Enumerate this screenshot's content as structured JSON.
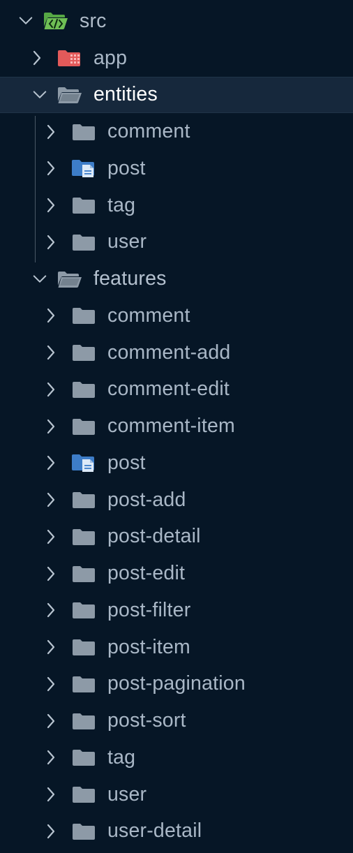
{
  "tree": [
    {
      "id": "src",
      "label": "src",
      "depth": 0,
      "expanded": true,
      "icon": "folder-src-open-icon",
      "root": true
    },
    {
      "id": "app",
      "label": "app",
      "depth": 1,
      "expanded": false,
      "icon": "folder-app-icon"
    },
    {
      "id": "entities",
      "label": "entities",
      "depth": 1,
      "expanded": true,
      "icon": "folder-open-icon",
      "selected": true
    },
    {
      "id": "entities-comment",
      "label": "comment",
      "depth": 2,
      "expanded": false,
      "icon": "folder-icon"
    },
    {
      "id": "entities-post",
      "label": "post",
      "depth": 2,
      "expanded": false,
      "icon": "folder-post-icon"
    },
    {
      "id": "entities-tag",
      "label": "tag",
      "depth": 2,
      "expanded": false,
      "icon": "folder-icon"
    },
    {
      "id": "entities-user",
      "label": "user",
      "depth": 2,
      "expanded": false,
      "icon": "folder-icon"
    },
    {
      "id": "features",
      "label": "features",
      "depth": 1,
      "expanded": true,
      "icon": "folder-open-icon"
    },
    {
      "id": "features-comment",
      "label": "comment",
      "depth": 2,
      "expanded": false,
      "icon": "folder-icon"
    },
    {
      "id": "features-comment-add",
      "label": "comment-add",
      "depth": 2,
      "expanded": false,
      "icon": "folder-icon"
    },
    {
      "id": "features-comment-edit",
      "label": "comment-edit",
      "depth": 2,
      "expanded": false,
      "icon": "folder-icon"
    },
    {
      "id": "features-comment-item",
      "label": "comment-item",
      "depth": 2,
      "expanded": false,
      "icon": "folder-icon"
    },
    {
      "id": "features-post",
      "label": "post",
      "depth": 2,
      "expanded": false,
      "icon": "folder-post-icon"
    },
    {
      "id": "features-post-add",
      "label": "post-add",
      "depth": 2,
      "expanded": false,
      "icon": "folder-icon"
    },
    {
      "id": "features-post-detail",
      "label": "post-detail",
      "depth": 2,
      "expanded": false,
      "icon": "folder-icon"
    },
    {
      "id": "features-post-edit",
      "label": "post-edit",
      "depth": 2,
      "expanded": false,
      "icon": "folder-icon"
    },
    {
      "id": "features-post-filter",
      "label": "post-filter",
      "depth": 2,
      "expanded": false,
      "icon": "folder-icon"
    },
    {
      "id": "features-post-item",
      "label": "post-item",
      "depth": 2,
      "expanded": false,
      "icon": "folder-icon"
    },
    {
      "id": "features-post-pagination",
      "label": "post-pagination",
      "depth": 2,
      "expanded": false,
      "icon": "folder-icon"
    },
    {
      "id": "features-post-sort",
      "label": "post-sort",
      "depth": 2,
      "expanded": false,
      "icon": "folder-icon"
    },
    {
      "id": "features-tag",
      "label": "tag",
      "depth": 2,
      "expanded": false,
      "icon": "folder-icon"
    },
    {
      "id": "features-user",
      "label": "user",
      "depth": 2,
      "expanded": false,
      "icon": "folder-icon"
    },
    {
      "id": "features-user-detail",
      "label": "user-detail",
      "depth": 2,
      "expanded": false,
      "icon": "folder-icon"
    }
  ],
  "colors": {
    "background": "#061626",
    "selected_row": "#16283c",
    "label": "#a9b7c6",
    "selected_label": "#ffffff",
    "folder": "#8d9aa7",
    "folder_src": "#56a845",
    "folder_app": "#e25a5a",
    "folder_post": "#3d7dc8"
  }
}
